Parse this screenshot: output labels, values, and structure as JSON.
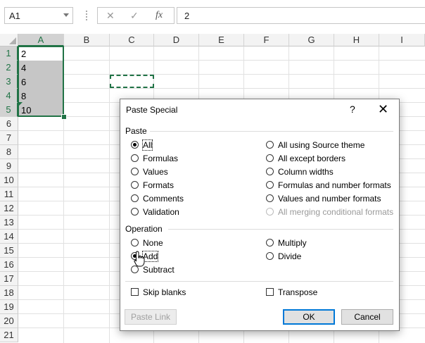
{
  "formula_bar": {
    "name_box": "A1",
    "cancel_icon": "✕",
    "enter_icon": "✓",
    "fx_label": "fx",
    "formula": "2"
  },
  "sheet": {
    "columns": [
      "A",
      "B",
      "C",
      "D",
      "E",
      "F",
      "G",
      "H",
      "I"
    ],
    "selected_column": "A",
    "rows": [
      "1",
      "2",
      "3",
      "4",
      "5",
      "6",
      "7",
      "8",
      "9",
      "10",
      "11",
      "12",
      "13",
      "14",
      "15",
      "16",
      "17",
      "18",
      "19",
      "20",
      "21"
    ],
    "selected_rows": [
      "1",
      "2",
      "3",
      "4",
      "5"
    ],
    "cells": {
      "A1": "2",
      "A2": "4",
      "A3": "6",
      "A4": "8",
      "A5": "10"
    },
    "selection_range": "A1:A5",
    "copy_range": "C3"
  },
  "dialog": {
    "title": "Paste Special",
    "help": "?",
    "close": "✕",
    "paste_section": "Paste",
    "paste_options_left": [
      "All",
      "Formulas",
      "Values",
      "Formats",
      "Comments",
      "Validation"
    ],
    "paste_options_right": [
      "All using Source theme",
      "All except borders",
      "Column widths",
      "Formulas and number formats",
      "Values and number formats",
      "All merging conditional formats"
    ],
    "paste_selected": "All",
    "paste_disabled": [
      "All merging conditional formats"
    ],
    "operation_section": "Operation",
    "operation_options_left": [
      "None",
      "Add",
      "Subtract"
    ],
    "operation_options_right": [
      "Multiply",
      "Divide"
    ],
    "operation_selected": "Add",
    "skip_blanks": "Skip blanks",
    "transpose": "Transpose",
    "skip_blanks_checked": false,
    "transpose_checked": false,
    "paste_link_button": "Paste Link",
    "ok_button": "OK",
    "cancel_button": "Cancel"
  },
  "colors": {
    "accent": "#217346",
    "selection_fill": "#c6c6c6",
    "default_button": "#0078d7"
  }
}
